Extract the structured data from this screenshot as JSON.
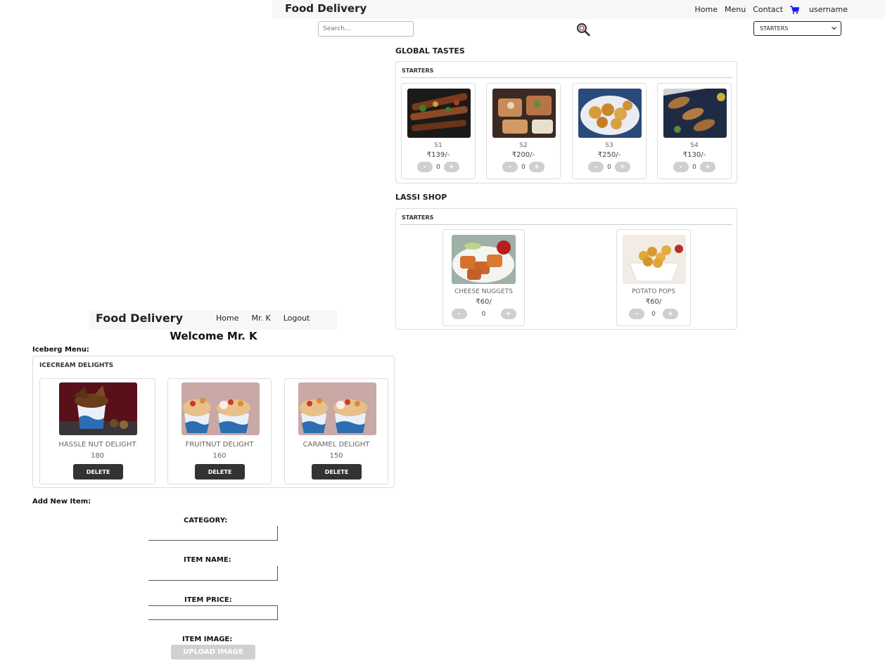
{
  "customer": {
    "brand": "Food Delivery",
    "nav": [
      "Home",
      "Menu",
      "Contact"
    ],
    "username": "username",
    "search_placeholder": "Search...",
    "category_select": "STARTERS",
    "restaurants": [
      {
        "name": "GLOBAL TASTES",
        "category": "STARTERS",
        "items": [
          {
            "name": "S1",
            "price": "₹139/-",
            "qty": "0",
            "minus": "-",
            "plus": "+"
          },
          {
            "name": "S2",
            "price": "₹200/-",
            "qty": "0",
            "minus": "-",
            "plus": "+"
          },
          {
            "name": "S3",
            "price": "₹250/-",
            "qty": "0",
            "minus": "-",
            "plus": "+"
          },
          {
            "name": "S4",
            "price": "₹130/-",
            "qty": "0",
            "minus": "-",
            "plus": "+"
          }
        ]
      },
      {
        "name": "LASSI SHOP",
        "category": "STARTERS",
        "items": [
          {
            "name": "CHEESE NUGGETS",
            "price": "₹60/",
            "qty": "0",
            "minus": "-",
            "plus": "+"
          },
          {
            "name": "POTATO POPS",
            "price": "₹60/",
            "qty": "0",
            "minus": "-",
            "plus": "+"
          }
        ]
      }
    ]
  },
  "admin": {
    "brand": "Food Delivery",
    "nav": [
      "Home",
      "Mr. K",
      "Logout"
    ],
    "welcome": "Welcome Mr. K",
    "menu_title": "Iceberg Menu:",
    "category": "ICECREAM DELIGHTS",
    "items": [
      {
        "name": "HASSLE NUT DELIGHT",
        "price": "180",
        "action": "DELETE"
      },
      {
        "name": "FRUITNUT DELIGHT",
        "price": "160",
        "action": "DELETE"
      },
      {
        "name": "CARAMEL DELIGHT",
        "price": "150",
        "action": "DELETE"
      }
    ],
    "add_title": "Add New Item:",
    "form": {
      "category_label": "CATEGORY:",
      "name_label": "ITEM NAME:",
      "price_label": "ITEM PRICE:",
      "image_label": "ITEM IMAGE:",
      "upload_label": "UPLOAD IMAGE"
    }
  },
  "colors": {
    "cart": "#1a1aff",
    "delete": "#333333",
    "qty_button": "#cfcfcf"
  }
}
